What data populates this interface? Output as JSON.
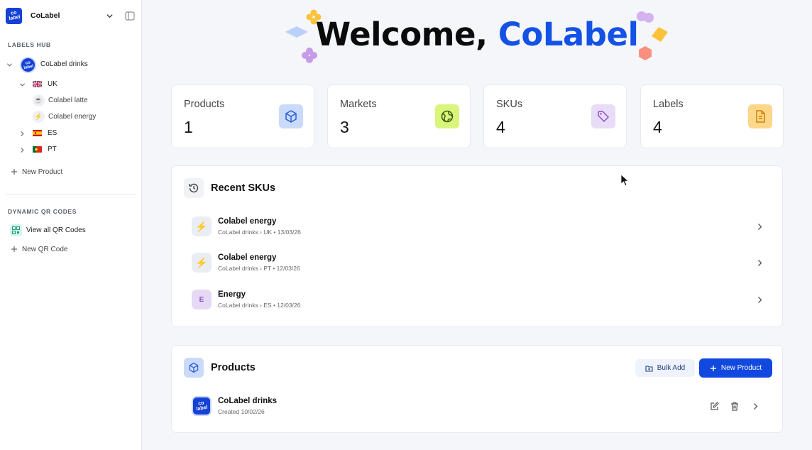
{
  "sidebar": {
    "workspace": {
      "logo_text": "co\nlabel",
      "name": "CoLabel"
    },
    "labels_hub": {
      "title": "LABELS HUB",
      "brand": {
        "name": "CoLabel drinks"
      },
      "markets": [
        {
          "code": "UK",
          "flag": "uk",
          "expanded": true,
          "products": [
            {
              "name": "Colabel latte",
              "icon": "coffee-cup-icon",
              "glyph": "☕"
            },
            {
              "name": "Colabel energy",
              "icon": "lightning-icon",
              "glyph": "⚡"
            }
          ]
        },
        {
          "code": "ES",
          "flag": "es",
          "expanded": false
        },
        {
          "code": "PT",
          "flag": "pt",
          "expanded": false
        }
      ],
      "new_product": "New Product"
    },
    "qr": {
      "title": "DYNAMIC QR CODES",
      "view_all": "View all QR Codes",
      "new_code": "New QR Code"
    }
  },
  "main": {
    "welcome_prefix": "Welcome, ",
    "welcome_name": "CoLabel",
    "stats": [
      {
        "label": "Products",
        "value": "1",
        "icon": "box-icon",
        "bg": "#c9dafb",
        "fg": "#2b5fd6"
      },
      {
        "label": "Markets",
        "value": "3",
        "icon": "globe-icon",
        "bg": "#d9f57a",
        "fg": "#3c5a12"
      },
      {
        "label": "SKUs",
        "value": "4",
        "icon": "tag-icon",
        "bg": "#e8dcf6",
        "fg": "#8a4fc9"
      },
      {
        "label": "Labels",
        "value": "4",
        "icon": "document-icon",
        "bg": "#fdd68a",
        "fg": "#c98200"
      }
    ],
    "recent_skus": {
      "title": "Recent SKUs",
      "items": [
        {
          "name": "Colabel energy",
          "meta": "CoLabel drinks › UK • 13/03/26",
          "avatar": "⚡",
          "avatar_type": "icon"
        },
        {
          "name": "Colabel energy",
          "meta": "CoLabel drinks › PT • 12/03/26",
          "avatar": "⚡",
          "avatar_type": "icon"
        },
        {
          "name": "Energy",
          "meta": "CoLabel drinks › ES • 12/03/26",
          "avatar": "E",
          "avatar_type": "letter"
        }
      ]
    },
    "products": {
      "title": "Products",
      "bulk_add": "Bulk Add",
      "new_product": "New Product",
      "items": [
        {
          "name": "CoLabel drinks",
          "meta": "Created 10/02/26"
        }
      ]
    }
  },
  "colors": {
    "accent": "#1148e0",
    "welcome_highlight": "#1452e6"
  }
}
